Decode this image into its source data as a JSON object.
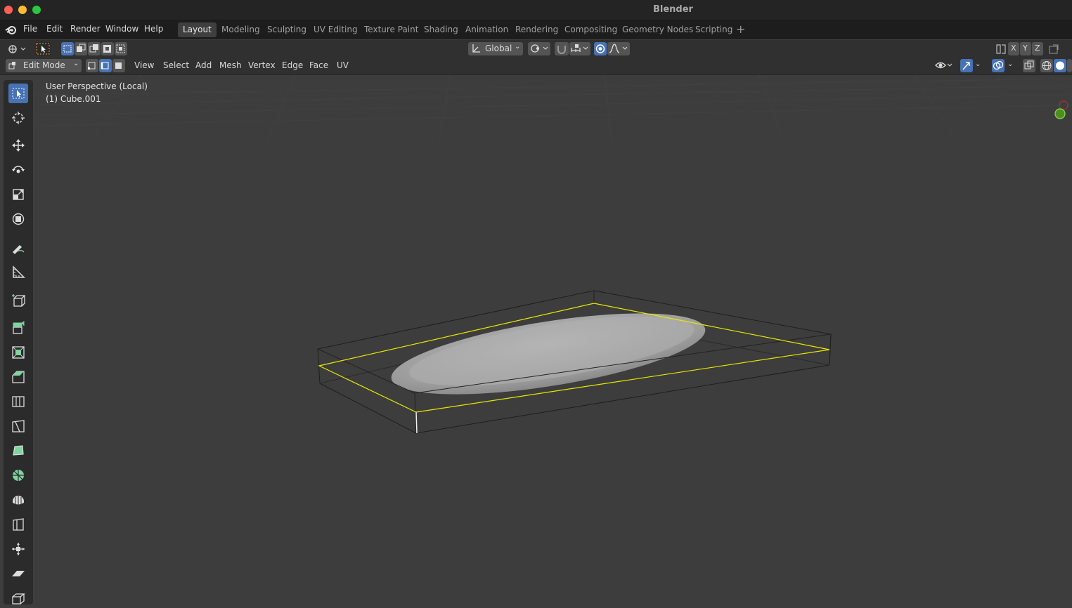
{
  "window": {
    "title": "Blender"
  },
  "menu": {
    "file": "File",
    "edit": "Edit",
    "render": "Render",
    "window": "Window",
    "help": "Help"
  },
  "workspaces": [
    "Layout",
    "Modeling",
    "Sculpting",
    "UV Editing",
    "Texture Paint",
    "Shading",
    "Animation",
    "Rendering",
    "Compositing",
    "Geometry Nodes",
    "Scripting"
  ],
  "active_workspace": "Layout",
  "tool_header": {
    "transform_orientation": "Global",
    "axes": [
      "X",
      "Y",
      "Z"
    ]
  },
  "editor_header": {
    "mode": "Edit Mode",
    "menus": [
      "View",
      "Select",
      "Add",
      "Mesh",
      "Vertex",
      "Edge",
      "Face",
      "UV"
    ]
  },
  "viewport": {
    "view_name": "User Perspective (Local)",
    "object_name": "(1) Cube.001"
  },
  "toolbar_tools": [
    "select-box",
    "cursor",
    "move",
    "rotate",
    "scale",
    "transform",
    "annotate",
    "measure",
    "add-cube",
    "extrude-region",
    "inset-faces",
    "bevel",
    "loop-cut",
    "knife",
    "poly-build",
    "spin",
    "smooth",
    "edge-slide",
    "shrink-fatten",
    "shear",
    "rip-region"
  ],
  "colors": {
    "accent": "#4772b3",
    "selection": "#ffff00",
    "background": "#3d3d3d"
  }
}
